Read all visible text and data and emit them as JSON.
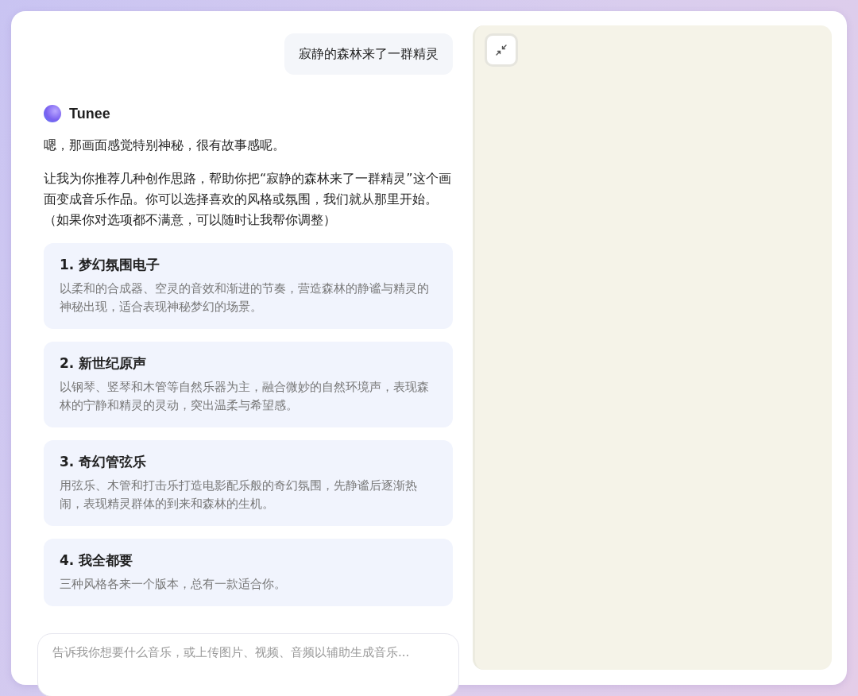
{
  "user_message": {
    "text": "寂静的森林来了一群精灵"
  },
  "assistant": {
    "name": "Tunee",
    "paragraphs": [
      "嗯，那画面感觉特别神秘，很有故事感呢。",
      "让我为你推荐几种创作思路，帮助你把“寂静的森林来了一群精灵”这个画面变成音乐作品。你可以选择喜欢的风格或氛围，我们就从那里开始。（如果你对选项都不满意，可以随时让我帮你调整）"
    ],
    "options": [
      {
        "title": "1. 梦幻氛围电子",
        "description": "以柔和的合成器、空灵的音效和渐进的节奏，营造森林的静谧与精灵的神秘出现，适合表现神秘梦幻的场景。"
      },
      {
        "title": "2. 新世纪原声",
        "description": "以钢琴、竖琴和木管等自然乐器为主，融合微妙的自然环境声，表现森林的宁静和精灵的灵动，突出温柔与希望感。"
      },
      {
        "title": "3. 奇幻管弦乐",
        "description": "用弦乐、木管和打击乐打造电影配乐般的奇幻氛围，先静谧后逐渐热闹，表现精灵群体的到来和森林的生机。"
      },
      {
        "title": "4. 我全都要",
        "description": "三种风格各来一个版本，总有一款适合你。"
      }
    ]
  },
  "input": {
    "placeholder": "告诉我你想要什么音乐，或上传图片、视频、音频以辅助生成音乐..."
  }
}
